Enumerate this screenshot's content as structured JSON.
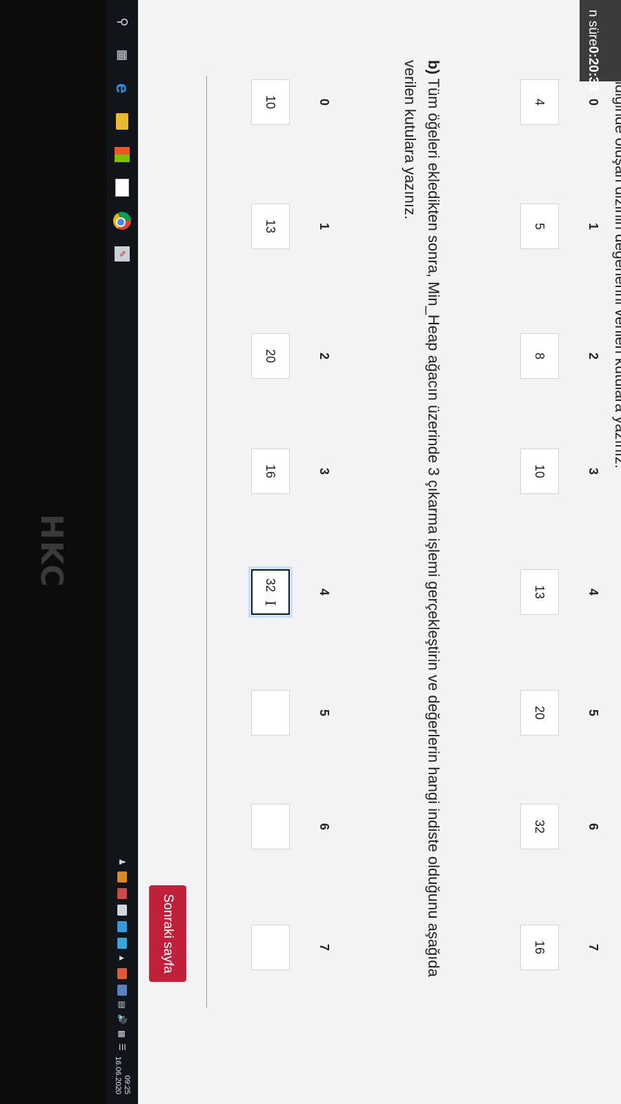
{
  "header": {
    "cutoff_text": "eklendiğinde oluşan dizinin değerlerini verilen kutulara yazınız.",
    "timer_prefix": "n süre ",
    "timer_value": "0:20:33"
  },
  "array_a": {
    "indices": [
      "0",
      "1",
      "2",
      "3",
      "4",
      "5",
      "6",
      "7"
    ],
    "values": [
      "4",
      "5",
      "8",
      "10",
      "13",
      "20",
      "32",
      "16"
    ]
  },
  "question_b": {
    "label": "b)",
    "text": " Tüm öğeleri ekledikten sonra, Min_Heap ağacın üzerinde 3 çıkarma işlemi gerçekleştirin ve değerlerin hangi indiste olduğunu aşağıda verilen kutulara yazınız."
  },
  "array_b": {
    "indices": [
      "0",
      "1",
      "2",
      "3",
      "4",
      "5",
      "6",
      "7"
    ],
    "values": [
      "10",
      "13",
      "20",
      "16",
      "32",
      "",
      "",
      ""
    ],
    "cursor_glyph": "I"
  },
  "next_button": {
    "label": "Sonraki sayfa",
    "color": "#c0203a"
  },
  "taskbar": {
    "icons": [
      "search-icon",
      "task-view-icon",
      "edge-icon",
      "file-explorer-icon",
      "store-icon",
      "mail-icon",
      "chrome-icon",
      "app-icon"
    ],
    "clock_time": "09:25",
    "clock_date": "16.06.2020"
  },
  "bezel": {
    "brand": "HKC"
  }
}
